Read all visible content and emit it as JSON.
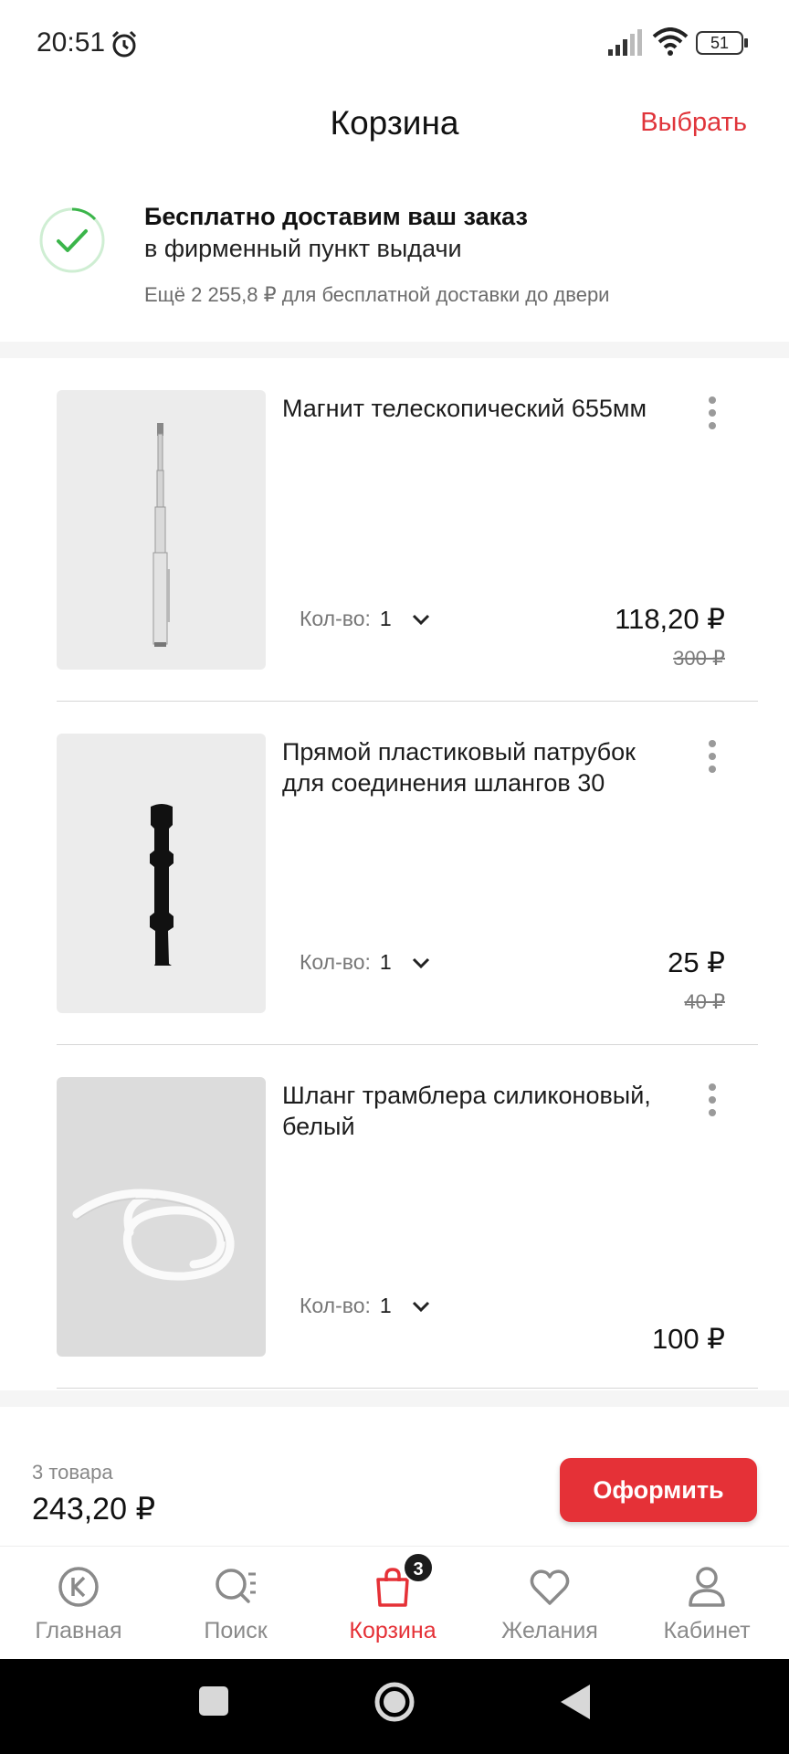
{
  "status_bar": {
    "time": "20:51",
    "battery": "51"
  },
  "header": {
    "title": "Корзина",
    "select_label": "Выбрать"
  },
  "delivery": {
    "title": "Бесплатно доставим ваш заказ",
    "subtitle": "в фирменный пункт выдачи",
    "note": "Ещё 2 255,8 ₽ для бесплатной доставки до двери"
  },
  "cart": {
    "qty_label": "Кол-во:",
    "items": [
      {
        "title": "Магнит телескопический 655мм",
        "qty": "1",
        "price": "118,20 ₽",
        "old_price": "300 ₽"
      },
      {
        "title": "Прямой пластиковый патрубок для соединения шлангов 30",
        "qty": "1",
        "price": "25 ₽",
        "old_price": "40 ₽"
      },
      {
        "title": "Шланг трамблера силиконовый, белый",
        "qty": "1",
        "price": "100 ₽",
        "old_price": ""
      }
    ]
  },
  "summary": {
    "count": "3 товара",
    "total": "243,20 ₽",
    "checkout_label": "Оформить"
  },
  "bottom_nav": {
    "items": [
      {
        "label": "Главная",
        "icon": "home-logo-icon"
      },
      {
        "label": "Поиск",
        "icon": "search-icon"
      },
      {
        "label": "Корзина",
        "icon": "cart-bag-icon",
        "badge": "3"
      },
      {
        "label": "Желания",
        "icon": "heart-icon"
      },
      {
        "label": "Кабинет",
        "icon": "profile-icon"
      }
    ]
  },
  "colors": {
    "accent": "#e53137",
    "success": "#3bb54a",
    "text": "#1c1c1c"
  }
}
